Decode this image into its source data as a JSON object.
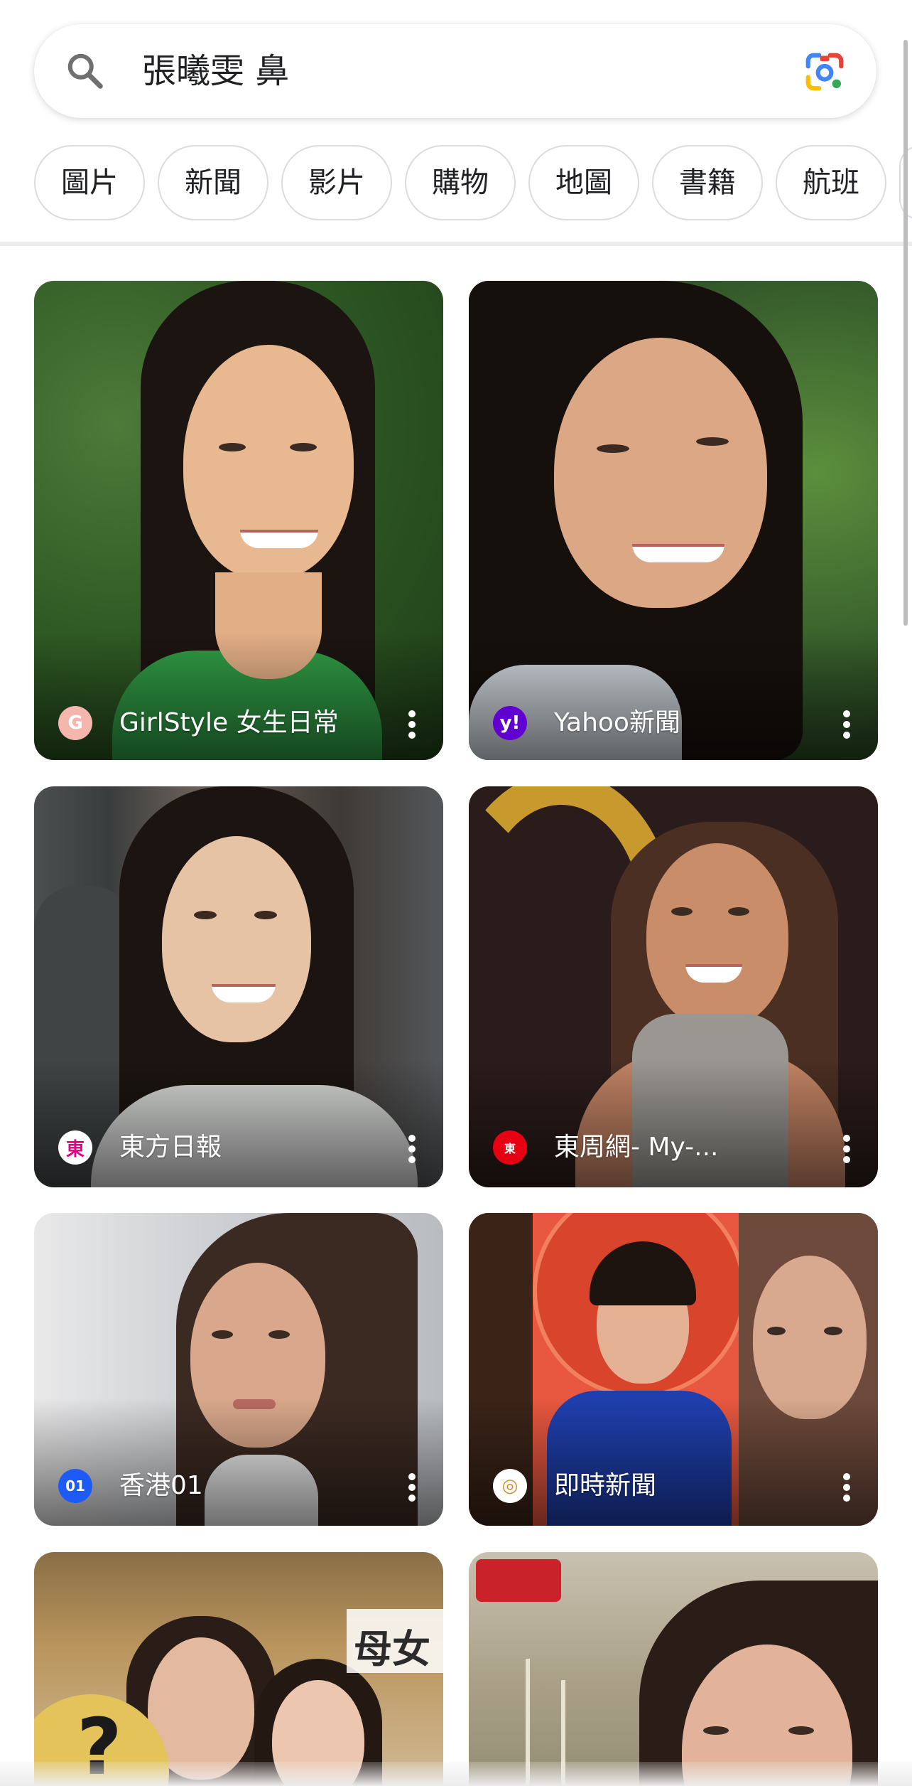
{
  "search": {
    "query": "張曦雯 鼻"
  },
  "chips": [
    "圖片",
    "新聞",
    "影片",
    "購物",
    "地圖",
    "書籍",
    "航班"
  ],
  "results": [
    {
      "source": "GirlStyle 女生日常",
      "icon_text": "G",
      "icon_color": "#f08a7e"
    },
    {
      "source": "Yahoo新聞",
      "icon_text": "y!",
      "icon_color": "#6001d2"
    },
    {
      "source": "東方日報",
      "icon_text": "東",
      "icon_color": "#ffffff"
    },
    {
      "source": "東周網- My-...",
      "icon_text": "東",
      "icon_color": "#e60012"
    },
    {
      "source": "香港01",
      "icon_text": "01",
      "icon_color": "#1e5bf6"
    },
    {
      "source": "即時新聞",
      "icon_text": "◎",
      "icon_color": "#ffffff"
    }
  ],
  "overlay_text": {
    "card7_sign": "母女",
    "card7_question": "?"
  },
  "colors": {
    "chip_border": "#dadce0",
    "lens_blue": "#4285f4",
    "lens_red": "#ea4335",
    "lens_yellow": "#fbbc04",
    "lens_green": "#34a853"
  }
}
